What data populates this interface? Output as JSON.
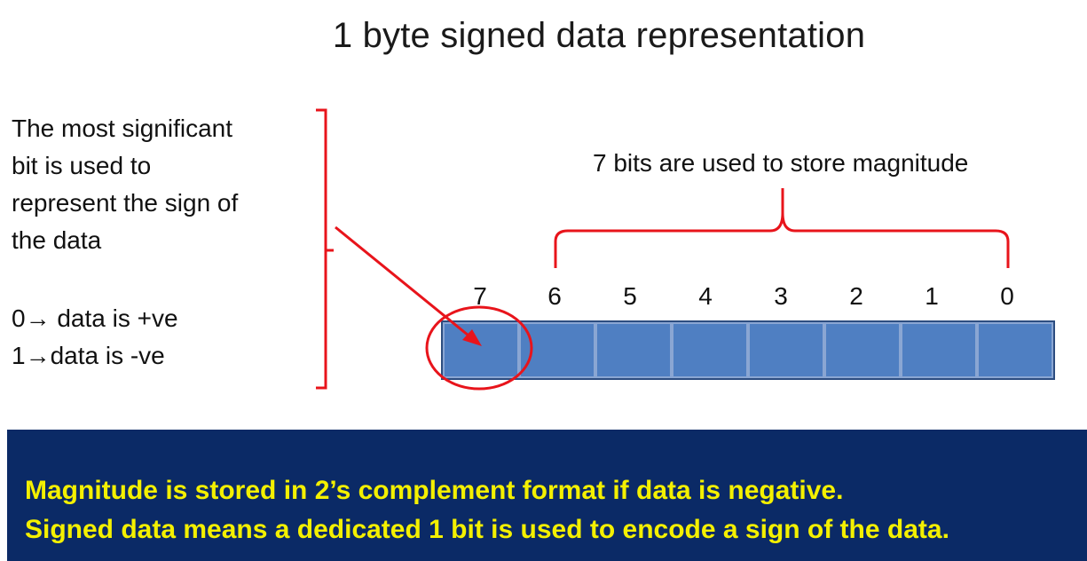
{
  "title": "1 byte signed data representation",
  "sign_note": {
    "lines": [
      "The most significant",
      "bit is used to",
      "represent the sign of",
      "the data"
    ]
  },
  "sign_rule": {
    "positive": "0→ data is +ve",
    "negative": "1→data is -ve"
  },
  "magnitude_label": "7 bits are used to store magnitude",
  "bits": [
    "7",
    "6",
    "5",
    "4",
    "3",
    "2",
    "1",
    "0"
  ],
  "colors": {
    "annotation": "#e8141b",
    "cell_fill": "#4f7fc2",
    "banner_bg": "#0b2a66",
    "banner_text": "#f4f000"
  },
  "banner": {
    "line1": "Magnitude is stored in 2’s complement format if data is negative.",
    "line2": "Signed data means a dedicated 1 bit is used to encode a sign of the data."
  }
}
